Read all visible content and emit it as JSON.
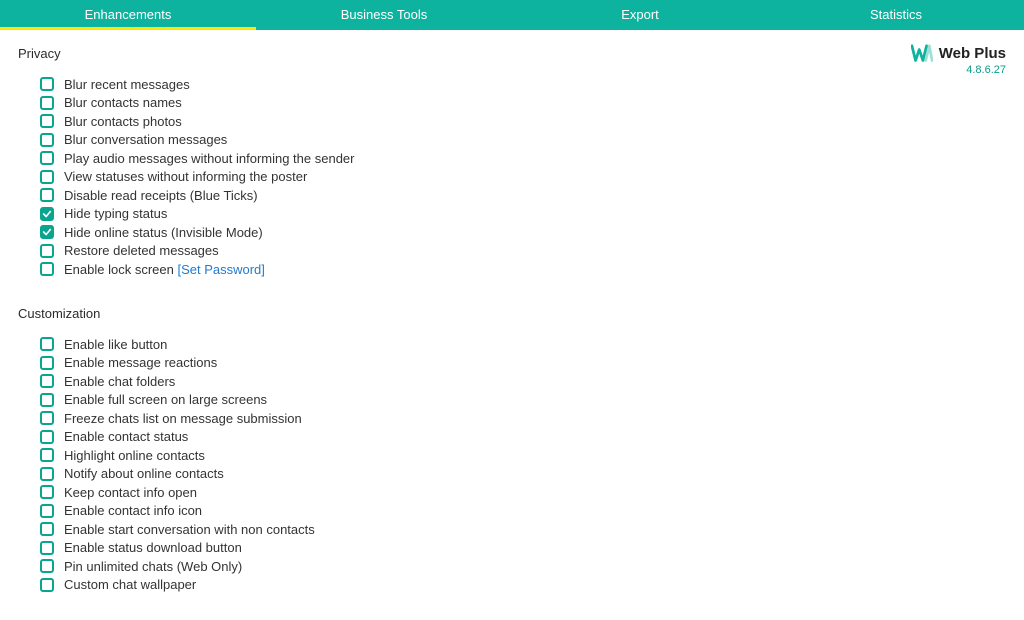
{
  "tabs": [
    {
      "label": "Enhancements",
      "active": true
    },
    {
      "label": "Business Tools",
      "active": false
    },
    {
      "label": "Export",
      "active": false
    },
    {
      "label": "Statistics",
      "active": false
    }
  ],
  "brand": {
    "name": "Web Plus",
    "version": "4.8.6.27",
    "logo_color": "#0db39e"
  },
  "sections": [
    {
      "title": "Privacy",
      "options": [
        {
          "label": "Blur recent messages",
          "checked": false
        },
        {
          "label": "Blur contacts names",
          "checked": false
        },
        {
          "label": "Blur contacts photos",
          "checked": false
        },
        {
          "label": "Blur conversation messages",
          "checked": false
        },
        {
          "label": "Play audio messages without informing the sender",
          "checked": false
        },
        {
          "label": "View statuses without informing the poster",
          "checked": false
        },
        {
          "label": "Disable read receipts (Blue Ticks)",
          "checked": false
        },
        {
          "label": "Hide typing status",
          "checked": true
        },
        {
          "label": "Hide online status (Invisible Mode)",
          "checked": true
        },
        {
          "label": "Restore deleted messages",
          "checked": false
        },
        {
          "label": "Enable lock screen ",
          "checked": false,
          "link": "[Set Password]"
        }
      ]
    },
    {
      "title": "Customization",
      "options": [
        {
          "label": "Enable like button",
          "checked": false
        },
        {
          "label": "Enable message reactions",
          "checked": false
        },
        {
          "label": "Enable chat folders",
          "checked": false
        },
        {
          "label": "Enable full screen on large screens",
          "checked": false
        },
        {
          "label": "Freeze chats list on message submission",
          "checked": false
        },
        {
          "label": "Enable contact status",
          "checked": false
        },
        {
          "label": "Highlight online contacts",
          "checked": false
        },
        {
          "label": "Notify about online contacts",
          "checked": false
        },
        {
          "label": "Keep contact info open",
          "checked": false
        },
        {
          "label": "Enable contact info icon",
          "checked": false
        },
        {
          "label": "Enable start conversation with non contacts",
          "checked": false
        },
        {
          "label": "Enable status download button",
          "checked": false
        },
        {
          "label": "Pin unlimited chats (Web Only)",
          "checked": false
        },
        {
          "label": "Custom chat wallpaper",
          "checked": false
        }
      ]
    }
  ]
}
